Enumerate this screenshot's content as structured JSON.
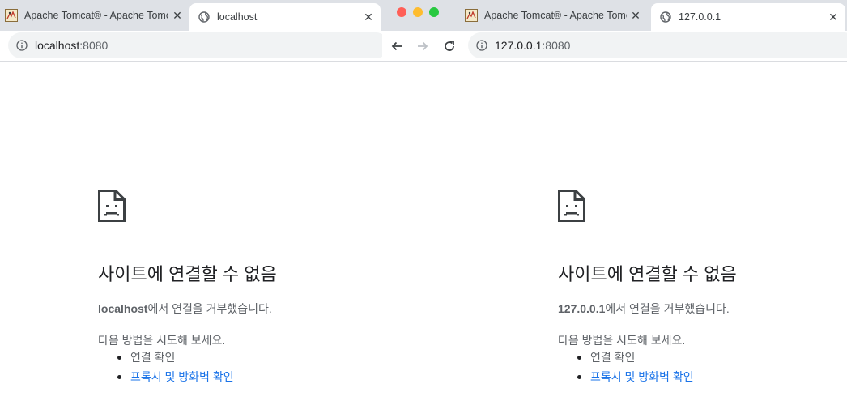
{
  "left_window": {
    "tabs": [
      {
        "title": "Apache Tomcat® - Apache Tomcat",
        "favicon": "tomcat-favicon",
        "active": false
      },
      {
        "title": "localhost",
        "favicon": "globe-icon",
        "active": true
      }
    ],
    "omnibox": {
      "host": "localhost",
      "port": ":8080"
    },
    "error": {
      "title": "사이트에 연결할 수 없음",
      "host": "localhost",
      "message_suffix": "에서 연결을 거부했습니다.",
      "try_label": "다음 방법을 시도해 보세요.",
      "suggestions": [
        "연결 확인",
        "프록시 및 방화벽 확인"
      ]
    }
  },
  "right_window": {
    "tabs": [
      {
        "title": "Apache Tomcat® - Apache Tomcat",
        "favicon": "tomcat-favicon",
        "active": false
      },
      {
        "title": "127.0.0.1",
        "favicon": "globe-icon",
        "active": true
      }
    ],
    "omnibox": {
      "host": "127.0.0.1",
      "port": ":8080"
    },
    "error": {
      "title": "사이트에 연결할 수 없음",
      "host": "127.0.0.1",
      "message_suffix": "에서 연결을 거부했습니다.",
      "try_label": "다음 방법을 시도해 보세요.",
      "suggestions": [
        "연결 확인",
        "프록시 및 방화벽 확인"
      ]
    }
  },
  "colors": {
    "traffic_close": "#ff5f57",
    "traffic_minimize": "#febc2e",
    "traffic_zoom": "#28c840",
    "link": "#1a73e8",
    "tabstrip": "#dee1e6"
  }
}
